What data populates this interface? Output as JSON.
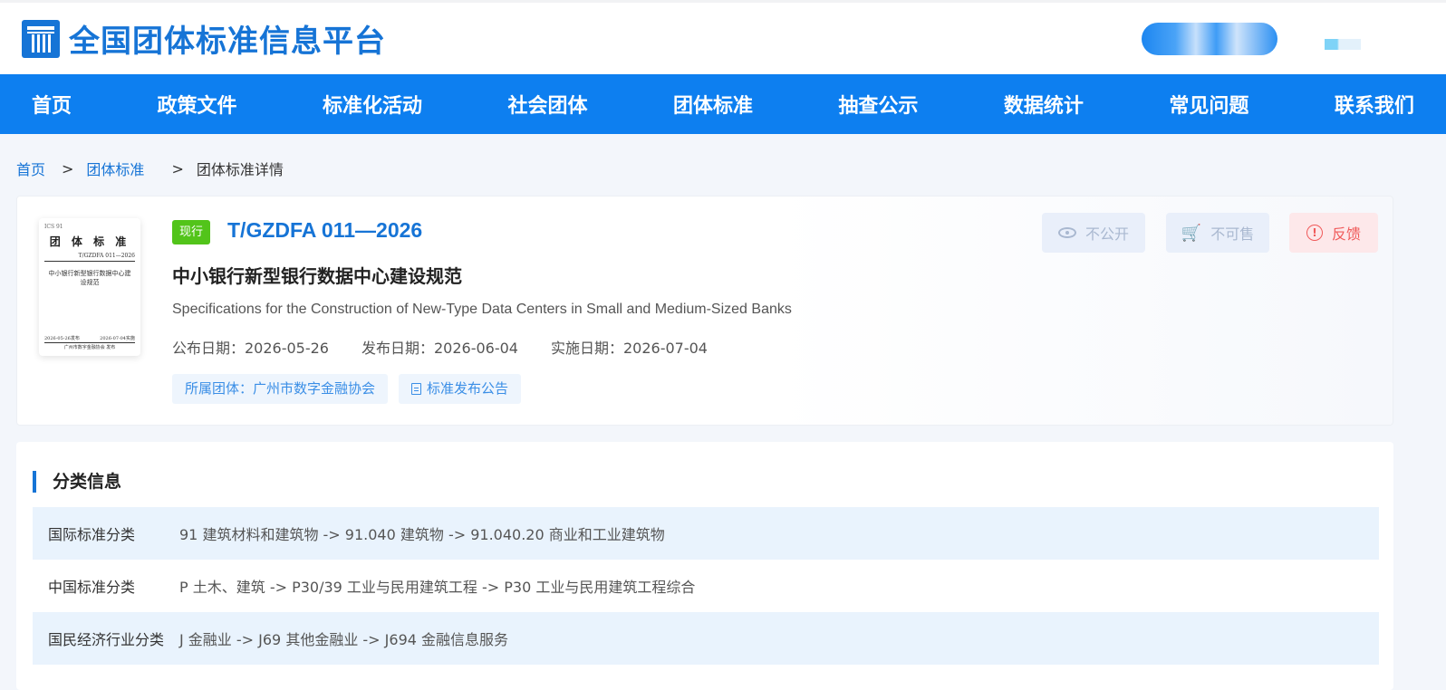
{
  "header": {
    "site_title": "全国团体标准信息平台",
    "logo_icon": "platform-logo-icon"
  },
  "nav": {
    "items": [
      "首页",
      "政策文件",
      "标准化活动",
      "社会团体",
      "团体标准",
      "抽查公示",
      "数据统计",
      "常见问题",
      "联系我们"
    ]
  },
  "breadcrumb": {
    "home": "首页",
    "sep": ">",
    "section": "团体标准",
    "current": "团体标准详情"
  },
  "standard": {
    "status": "现行",
    "code": "T/GZDFA 011—2026",
    "title": "中小银行新型银行数据中心建设规范",
    "title_en": "Specifications for the Construction of New-Type Data Centers in Small and Medium-Sized Banks",
    "announce_date": "公布日期：2026-05-26",
    "publish_date": "发布日期：2026-06-04",
    "effective_date": "实施日期：2026-07-04",
    "org_chip": "所属团体：广州市数字金融协会",
    "notice_chip": "标准发布公告",
    "cover": {
      "ics": "ICS 91",
      "heading": "团 体 标 准",
      "code": "T/GZDFA 011—2026",
      "name": "中小银行新型银行数据中心建设规范",
      "pub_date": "2026-05-26发布",
      "eff_date": "2026-07-04实施",
      "publisher": "广州市数字金融协会 发布"
    }
  },
  "actions": {
    "private_label": "不公开",
    "nosale_label": "不可售",
    "feedback_label": "反馈"
  },
  "classification": {
    "section_title": "分类信息",
    "rows": [
      {
        "label": "国际标准分类",
        "value": "91 建筑材料和建筑物 -> 91.040 建筑物 -> 91.040.20 商业和工业建筑物"
      },
      {
        "label": "中国标准分类",
        "value": "P 土木、建筑 -> P30/39 工业与民用建筑工程 -> P30 工业与民用建筑工程综合"
      },
      {
        "label": "国民经济行业分类",
        "value": "J 金融业 -> J69 其他金融业 -> J694 金融信息服务"
      }
    ]
  },
  "colors": {
    "brand_blue": "#1674d6",
    "nav_blue": "#0d7ff0",
    "status_green": "#52c41a",
    "feedback_red": "#f05a5a"
  }
}
